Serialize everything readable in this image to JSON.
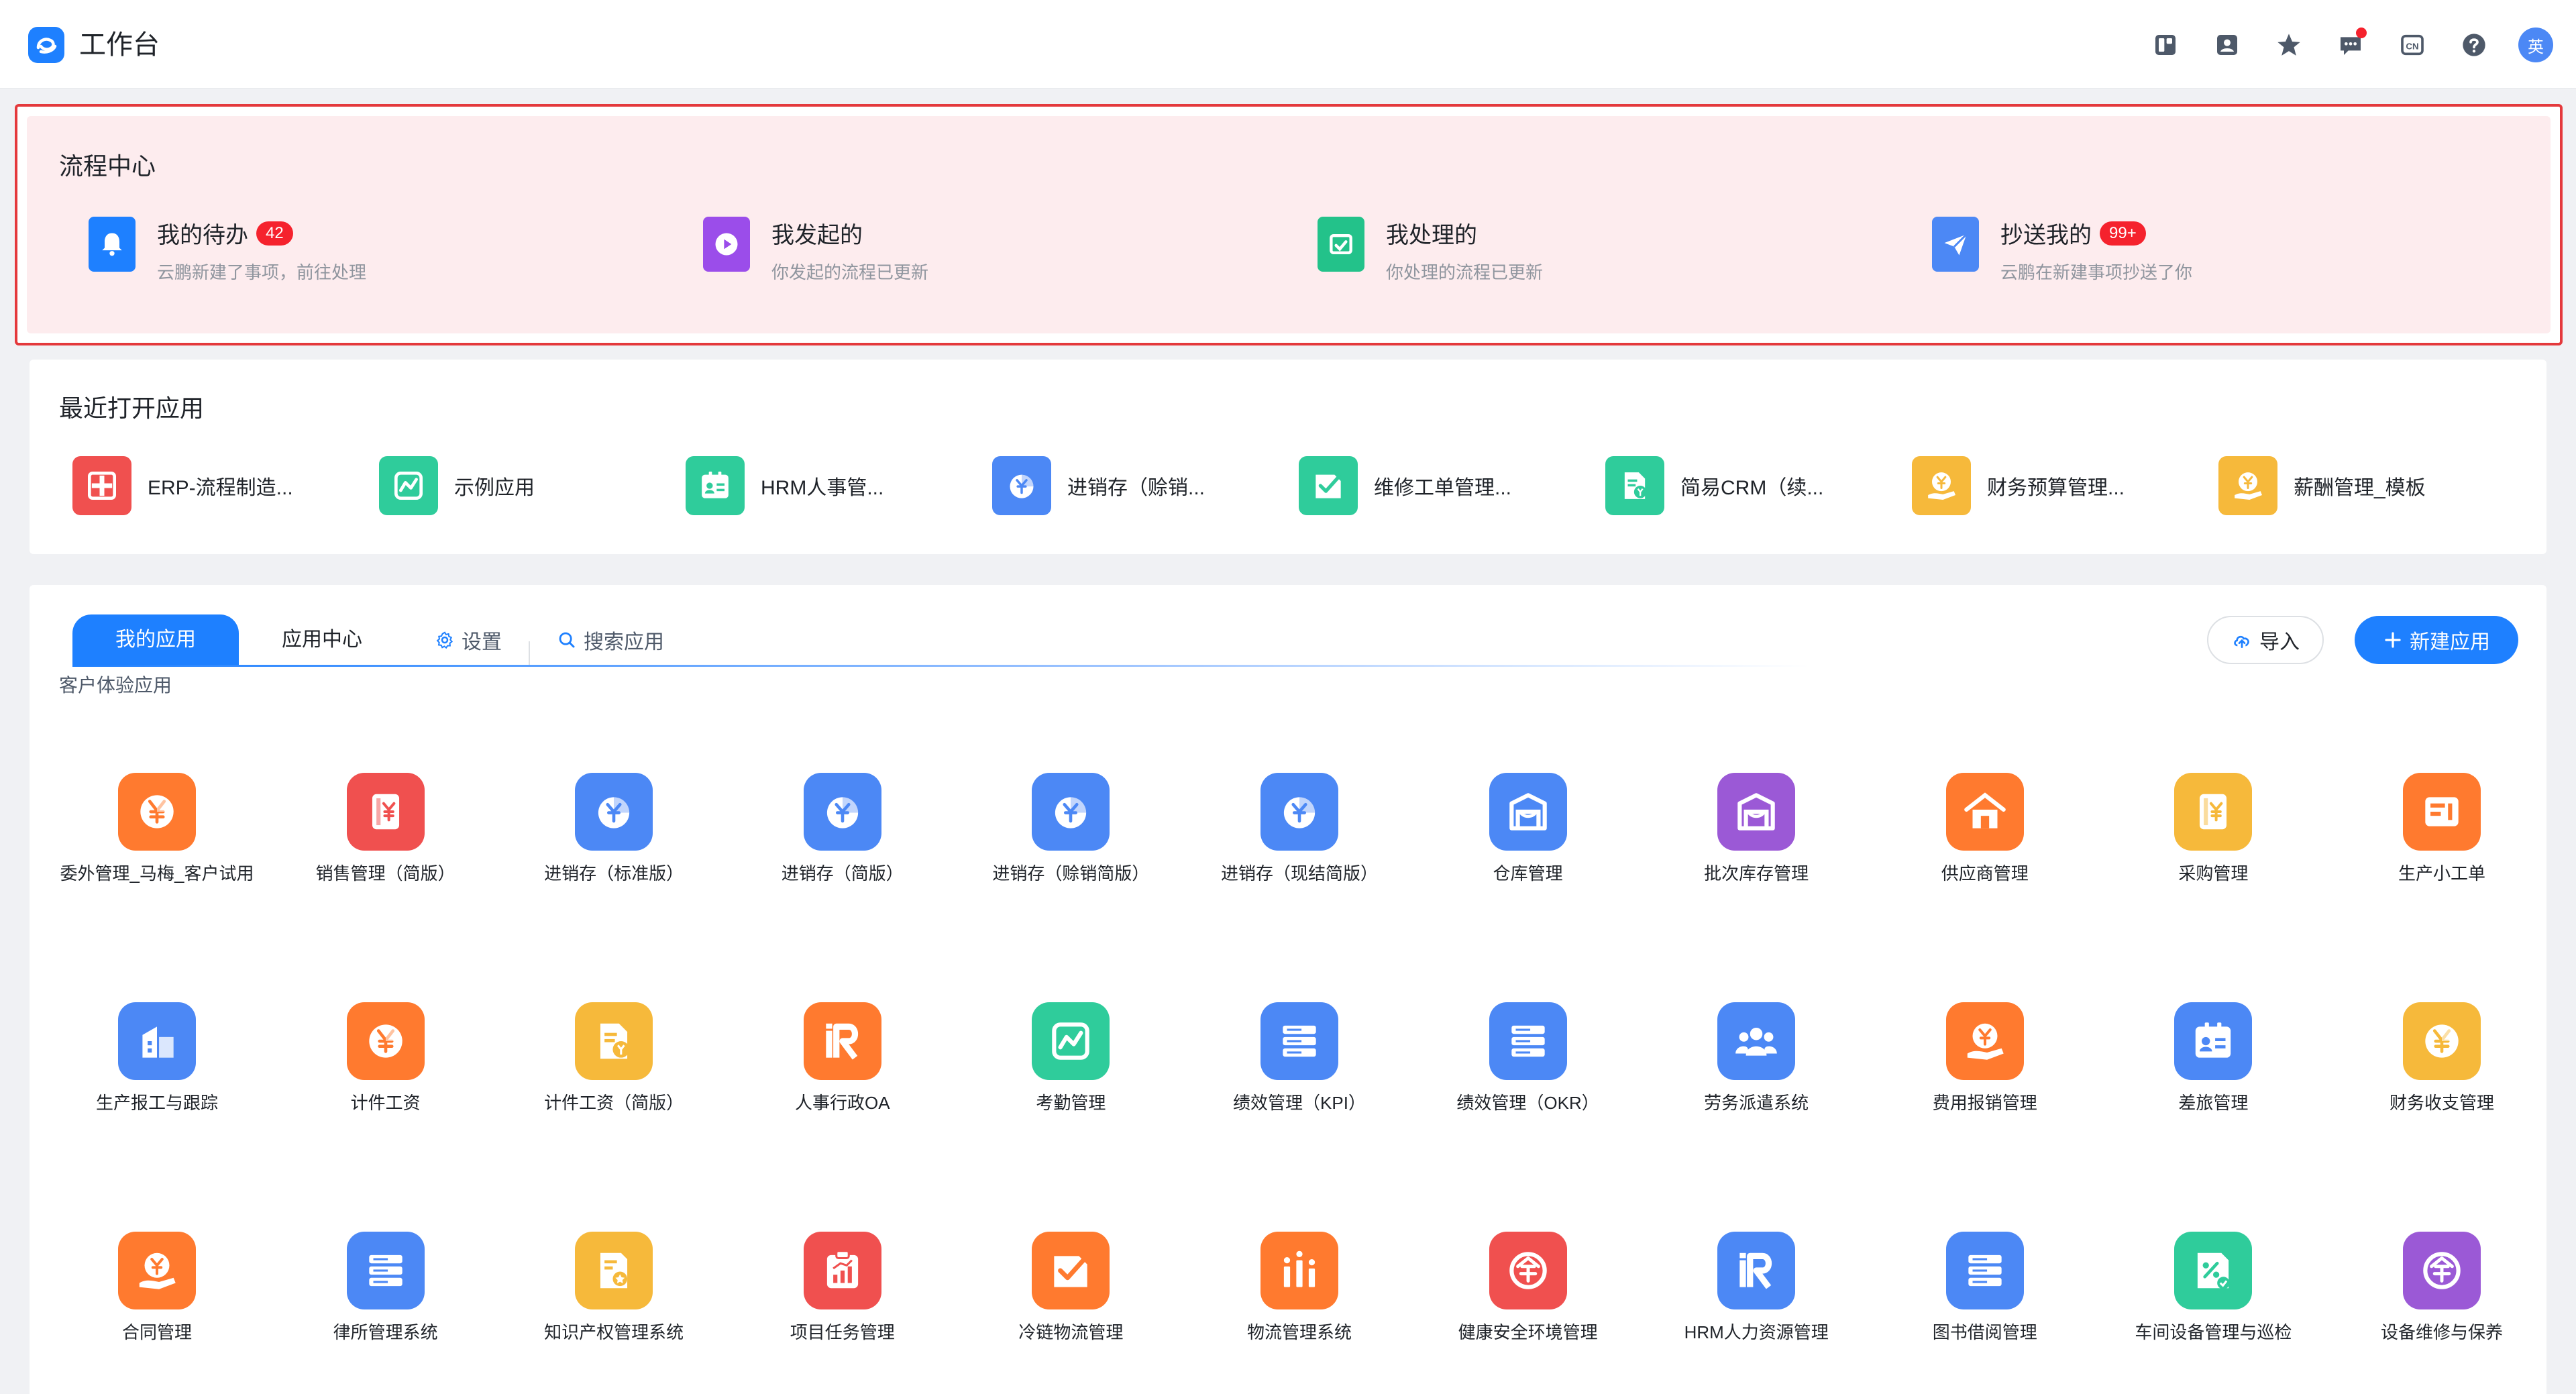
{
  "header": {
    "title": "工作台",
    "icons": [
      "layout-icon",
      "contacts-icon",
      "star-icon",
      "message-icon",
      "language-icon",
      "help-icon"
    ],
    "language_label": "CN",
    "avatar_text": "英"
  },
  "process_center": {
    "title": "流程中心",
    "items": [
      {
        "name": "我的待办",
        "badge": "42",
        "desc": "云鹏新建了事项，前往处理",
        "icon": "bell-icon",
        "color": "#1e80ff"
      },
      {
        "name": "我发起的",
        "badge": "",
        "desc": "你发起的流程已更新",
        "icon": "play-icon",
        "color": "#9b4dea"
      },
      {
        "name": "我处理的",
        "badge": "",
        "desc": "你处理的流程已更新",
        "icon": "inbox-icon",
        "color": "#23c28a"
      },
      {
        "name": "抄送我的",
        "badge": "99+",
        "desc": "云鹏在新建事项抄送了你",
        "icon": "send-icon",
        "color": "#4c88f5"
      }
    ]
  },
  "recent_apps": {
    "title": "最近打开应用",
    "items": [
      {
        "label": "ERP-流程制造...",
        "color": "#f0504f",
        "icon": "hospital-icon"
      },
      {
        "label": "示例应用",
        "color": "#2fcc9b",
        "icon": "chart-line-icon"
      },
      {
        "label": "HRM人事管...",
        "color": "#2fcc9b",
        "icon": "id-card-icon"
      },
      {
        "label": "进销存（赊销...",
        "color": "#4c88f5",
        "icon": "yen-pie-icon"
      },
      {
        "label": "维修工单管理...",
        "color": "#2fcc9b",
        "icon": "check-list-icon"
      },
      {
        "label": "简易CRM（续...",
        "color": "#2fcc9b",
        "icon": "document-yen-icon"
      },
      {
        "label": "财务预算管理...",
        "color": "#f6b93b",
        "icon": "yen-hand-icon"
      },
      {
        "label": "薪酬管理_模板",
        "color": "#f6b93b",
        "icon": "yen-hand-icon"
      }
    ]
  },
  "my_apps": {
    "tabs": [
      {
        "label": "我的应用",
        "active": true
      },
      {
        "label": "应用中心",
        "active": false
      }
    ],
    "settings_label": "设置",
    "search_label": "搜索应用",
    "import_label": "导入",
    "new_app_label": "新建应用",
    "group_label": "客户体验应用",
    "rows": [
      [
        {
          "label": "委外管理_马梅_客户试用",
          "color": "#ff7a2f",
          "icon": "yen-circle-icon"
        },
        {
          "label": "销售管理（简版）",
          "color": "#f0504f",
          "icon": "yen-doc-icon"
        },
        {
          "label": "进销存（标准版）",
          "color": "#4c88f5",
          "icon": "yen-pie-icon"
        },
        {
          "label": "进销存（简版）",
          "color": "#4c88f5",
          "icon": "yen-pie-icon"
        },
        {
          "label": "进销存（赊销简版）",
          "color": "#4c88f5",
          "icon": "yen-pie-icon"
        },
        {
          "label": "进销存（现结简版）",
          "color": "#4c88f5",
          "icon": "yen-pie-icon"
        },
        {
          "label": "仓库管理",
          "color": "#4c88f5",
          "icon": "warehouse-icon"
        },
        {
          "label": "批次库存管理",
          "color": "#9b59d6",
          "icon": "warehouse-icon"
        },
        {
          "label": "供应商管理",
          "color": "#ff7a2f",
          "icon": "house-icon"
        },
        {
          "label": "采购管理",
          "color": "#f6b93b",
          "icon": "yen-doc-icon"
        },
        {
          "label": "生产小工单",
          "color": "#ff7a2f",
          "icon": "ticket-icon"
        }
      ],
      [
        {
          "label": "生产报工与跟踪",
          "color": "#4c88f5",
          "icon": "building-doc-icon"
        },
        {
          "label": "计件工资",
          "color": "#ff7a2f",
          "icon": "yen-circle-icon"
        },
        {
          "label": "计件工资（简版）",
          "color": "#f6b93b",
          "icon": "document-yen-icon"
        },
        {
          "label": "人事行政OA",
          "color": "#ff7a2f",
          "icon": "hr-icon"
        },
        {
          "label": "考勤管理",
          "color": "#2fcc9b",
          "icon": "chart-line-icon"
        },
        {
          "label": "绩效管理（KPI）",
          "color": "#4c88f5",
          "icon": "server-list-icon"
        },
        {
          "label": "绩效管理（OKR）",
          "color": "#4c88f5",
          "icon": "server-list-icon"
        },
        {
          "label": "劳务派遣系统",
          "color": "#4c88f5",
          "icon": "users-icon"
        },
        {
          "label": "费用报销管理",
          "color": "#ff7a2f",
          "icon": "yen-hand-icon"
        },
        {
          "label": "差旅管理",
          "color": "#4c88f5",
          "icon": "id-card-icon"
        },
        {
          "label": "财务收支管理",
          "color": "#f6b93b",
          "icon": "yen-circle-icon"
        }
      ],
      [
        {
          "label": "合同管理",
          "color": "#ff7a2f",
          "icon": "yen-hand-icon"
        },
        {
          "label": "律所管理系统",
          "color": "#4c88f5",
          "icon": "server-list-icon"
        },
        {
          "label": "知识产权管理系统",
          "color": "#f6b93b",
          "icon": "certificate-icon"
        },
        {
          "label": "项目任务管理",
          "color": "#f0504f",
          "icon": "clipboard-chart-icon"
        },
        {
          "label": "冷链物流管理",
          "color": "#ff7a2f",
          "icon": "check-list-icon"
        },
        {
          "label": "物流管理系统",
          "color": "#ff7a2f",
          "icon": "bars-icon"
        },
        {
          "label": "健康安全环境管理",
          "color": "#f0504f",
          "icon": "enterprise-icon"
        },
        {
          "label": "HRM人力资源管理",
          "color": "#4c88f5",
          "icon": "hr-icon"
        },
        {
          "label": "图书借阅管理",
          "color": "#4c88f5",
          "icon": "server-list-icon"
        },
        {
          "label": "车间设备管理与巡检",
          "color": "#2fcc9b",
          "icon": "percent-doc-icon"
        },
        {
          "label": "设备维修与保养",
          "color": "#9b59d6",
          "icon": "enterprise-icon"
        }
      ]
    ]
  }
}
